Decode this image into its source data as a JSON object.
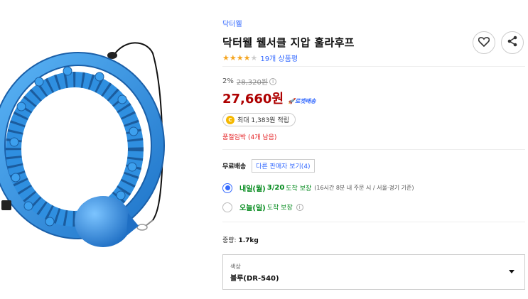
{
  "product": {
    "brand": "닥터웰",
    "title": "닥터웰 웰서클 지압 훌라후프",
    "stars_filled": 4,
    "stars_total": 5,
    "review_count_text": "19개 상품평"
  },
  "price": {
    "discount_rate": "2%",
    "original_price": "28,320원",
    "original_info_icon": "i",
    "sale_price": "27,660원",
    "delivery_badge": "로켓배송",
    "cashback_coin": "C",
    "cashback_text": "최대 1,383원 적립",
    "stock_text": "품절임박 (4개 남음)"
  },
  "shipping": {
    "label": "무료배송",
    "other_sellers_button": "다른 판매자 보기(4)",
    "options": [
      {
        "day": "내일(월)",
        "date": "3/20",
        "guarantee": "도착 보장",
        "note": "(16시간 8분 내 주문 시 / 서울·경기 기준)",
        "selected": true
      },
      {
        "day": "오늘(일)",
        "date": "",
        "guarantee": "도착 보장",
        "note": "",
        "selected": false
      }
    ]
  },
  "weight": {
    "label": "중량:",
    "value": "1.7kg"
  },
  "option_select": {
    "label": "색상",
    "value": "블루(DR-540)"
  },
  "colors": {
    "accent_blue": "#346aff",
    "price_red": "#ae0000",
    "stock_red": "#e52528",
    "delivery_green": "#00891a",
    "hoop_blue": "#2f8fe0"
  },
  "icons": {
    "heart": "heart-icon",
    "share": "share-icon",
    "rocket": "rocket-icon",
    "caret": "chevron-down-icon"
  }
}
